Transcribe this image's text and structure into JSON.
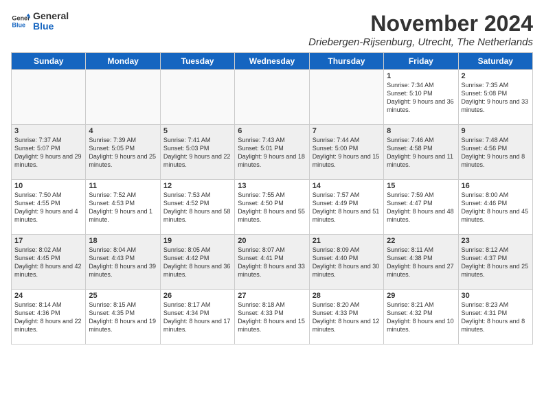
{
  "header": {
    "logo_general": "General",
    "logo_blue": "Blue",
    "month_year": "November 2024",
    "location": "Driebergen-Rijsenburg, Utrecht, The Netherlands"
  },
  "weekdays": [
    "Sunday",
    "Monday",
    "Tuesday",
    "Wednesday",
    "Thursday",
    "Friday",
    "Saturday"
  ],
  "weeks": [
    [
      {
        "day": "",
        "info": ""
      },
      {
        "day": "",
        "info": ""
      },
      {
        "day": "",
        "info": ""
      },
      {
        "day": "",
        "info": ""
      },
      {
        "day": "",
        "info": ""
      },
      {
        "day": "1",
        "info": "Sunrise: 7:34 AM\nSunset: 5:10 PM\nDaylight: 9 hours and 36 minutes."
      },
      {
        "day": "2",
        "info": "Sunrise: 7:35 AM\nSunset: 5:08 PM\nDaylight: 9 hours and 33 minutes."
      }
    ],
    [
      {
        "day": "3",
        "info": "Sunrise: 7:37 AM\nSunset: 5:07 PM\nDaylight: 9 hours and 29 minutes."
      },
      {
        "day": "4",
        "info": "Sunrise: 7:39 AM\nSunset: 5:05 PM\nDaylight: 9 hours and 25 minutes."
      },
      {
        "day": "5",
        "info": "Sunrise: 7:41 AM\nSunset: 5:03 PM\nDaylight: 9 hours and 22 minutes."
      },
      {
        "day": "6",
        "info": "Sunrise: 7:43 AM\nSunset: 5:01 PM\nDaylight: 9 hours and 18 minutes."
      },
      {
        "day": "7",
        "info": "Sunrise: 7:44 AM\nSunset: 5:00 PM\nDaylight: 9 hours and 15 minutes."
      },
      {
        "day": "8",
        "info": "Sunrise: 7:46 AM\nSunset: 4:58 PM\nDaylight: 9 hours and 11 minutes."
      },
      {
        "day": "9",
        "info": "Sunrise: 7:48 AM\nSunset: 4:56 PM\nDaylight: 9 hours and 8 minutes."
      }
    ],
    [
      {
        "day": "10",
        "info": "Sunrise: 7:50 AM\nSunset: 4:55 PM\nDaylight: 9 hours and 4 minutes."
      },
      {
        "day": "11",
        "info": "Sunrise: 7:52 AM\nSunset: 4:53 PM\nDaylight: 9 hours and 1 minute."
      },
      {
        "day": "12",
        "info": "Sunrise: 7:53 AM\nSunset: 4:52 PM\nDaylight: 8 hours and 58 minutes."
      },
      {
        "day": "13",
        "info": "Sunrise: 7:55 AM\nSunset: 4:50 PM\nDaylight: 8 hours and 55 minutes."
      },
      {
        "day": "14",
        "info": "Sunrise: 7:57 AM\nSunset: 4:49 PM\nDaylight: 8 hours and 51 minutes."
      },
      {
        "day": "15",
        "info": "Sunrise: 7:59 AM\nSunset: 4:47 PM\nDaylight: 8 hours and 48 minutes."
      },
      {
        "day": "16",
        "info": "Sunrise: 8:00 AM\nSunset: 4:46 PM\nDaylight: 8 hours and 45 minutes."
      }
    ],
    [
      {
        "day": "17",
        "info": "Sunrise: 8:02 AM\nSunset: 4:45 PM\nDaylight: 8 hours and 42 minutes."
      },
      {
        "day": "18",
        "info": "Sunrise: 8:04 AM\nSunset: 4:43 PM\nDaylight: 8 hours and 39 minutes."
      },
      {
        "day": "19",
        "info": "Sunrise: 8:05 AM\nSunset: 4:42 PM\nDaylight: 8 hours and 36 minutes."
      },
      {
        "day": "20",
        "info": "Sunrise: 8:07 AM\nSunset: 4:41 PM\nDaylight: 8 hours and 33 minutes."
      },
      {
        "day": "21",
        "info": "Sunrise: 8:09 AM\nSunset: 4:40 PM\nDaylight: 8 hours and 30 minutes."
      },
      {
        "day": "22",
        "info": "Sunrise: 8:11 AM\nSunset: 4:38 PM\nDaylight: 8 hours and 27 minutes."
      },
      {
        "day": "23",
        "info": "Sunrise: 8:12 AM\nSunset: 4:37 PM\nDaylight: 8 hours and 25 minutes."
      }
    ],
    [
      {
        "day": "24",
        "info": "Sunrise: 8:14 AM\nSunset: 4:36 PM\nDaylight: 8 hours and 22 minutes."
      },
      {
        "day": "25",
        "info": "Sunrise: 8:15 AM\nSunset: 4:35 PM\nDaylight: 8 hours and 19 minutes."
      },
      {
        "day": "26",
        "info": "Sunrise: 8:17 AM\nSunset: 4:34 PM\nDaylight: 8 hours and 17 minutes."
      },
      {
        "day": "27",
        "info": "Sunrise: 8:18 AM\nSunset: 4:33 PM\nDaylight: 8 hours and 15 minutes."
      },
      {
        "day": "28",
        "info": "Sunrise: 8:20 AM\nSunset: 4:33 PM\nDaylight: 8 hours and 12 minutes."
      },
      {
        "day": "29",
        "info": "Sunrise: 8:21 AM\nSunset: 4:32 PM\nDaylight: 8 hours and 10 minutes."
      },
      {
        "day": "30",
        "info": "Sunrise: 8:23 AM\nSunset: 4:31 PM\nDaylight: 8 hours and 8 minutes."
      }
    ]
  ]
}
